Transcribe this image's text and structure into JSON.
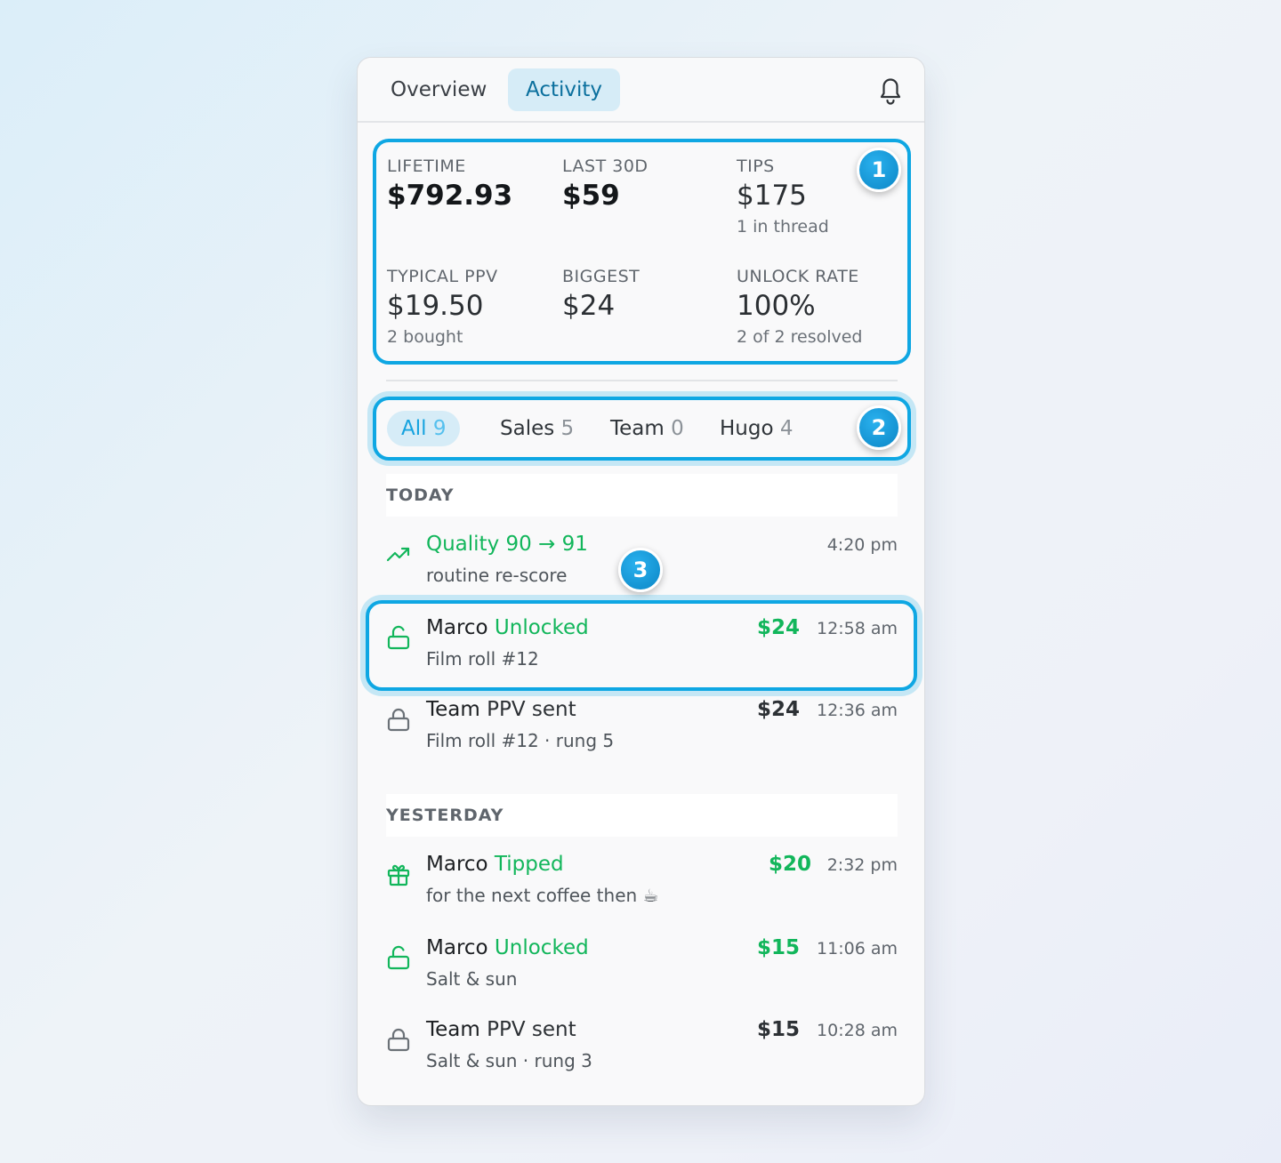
{
  "tabs": [
    {
      "label": "Overview",
      "active": false
    },
    {
      "label": "Activity",
      "active": true
    }
  ],
  "stats": {
    "lifetime": {
      "label": "LIFETIME",
      "value": "$792.93"
    },
    "last30": {
      "label": "LAST 30D",
      "value": "$59"
    },
    "tips": {
      "label": "TIPS",
      "value": "$175",
      "sub": "1 in thread"
    },
    "typical_ppv": {
      "label": "TYPICAL PPV",
      "value": "$19.50",
      "sub": "2 bought"
    },
    "biggest": {
      "label": "BIGGEST",
      "value": "$24"
    },
    "unlock_rate": {
      "label": "UNLOCK RATE",
      "value": "100%",
      "sub": "2 of 2 resolved"
    }
  },
  "filters": [
    {
      "label": "All",
      "count": "9",
      "active": true
    },
    {
      "label": "Sales",
      "count": "5"
    },
    {
      "label": "Team",
      "count": "0"
    },
    {
      "label": "Hugo",
      "count": "4"
    }
  ],
  "badges": [
    "1",
    "2",
    "3"
  ],
  "sections": {
    "today": "TODAY",
    "yesterday": "YESTERDAY"
  },
  "today": [
    {
      "icon": "trending-up-icon",
      "title": "Quality 90 → 91",
      "desc": "routine re-score",
      "time": "4:20 pm"
    },
    {
      "icon": "unlocked-icon",
      "actor": "Marco",
      "action": "Unlocked",
      "desc": "Film roll #12",
      "amount": "$24",
      "time": "12:58 am"
    },
    {
      "icon": "lock-icon",
      "actor": "Team",
      "action": "PPV sent",
      "desc": "Film roll #12 · rung 5",
      "amount": "$24",
      "time": "12:36 am"
    }
  ],
  "yesterday": [
    {
      "icon": "gift-icon",
      "actor": "Marco",
      "action": "Tipped",
      "desc": "for the next coffee then ☕",
      "amount": "$20",
      "time": "2:32 pm"
    },
    {
      "icon": "unlocked-icon",
      "actor": "Marco",
      "action": "Unlocked",
      "desc": "Salt & sun",
      "amount": "$15",
      "time": "11:06 am"
    },
    {
      "icon": "lock-icon",
      "actor": "Team",
      "action": "PPV sent",
      "desc": "Salt & sun · rung 3",
      "amount": "$15",
      "time": "10:28 am"
    }
  ],
  "colors": {
    "accent": "#0fa7e3",
    "positive": "#12b65b",
    "active_tab_bg": "#d6ecf7"
  }
}
